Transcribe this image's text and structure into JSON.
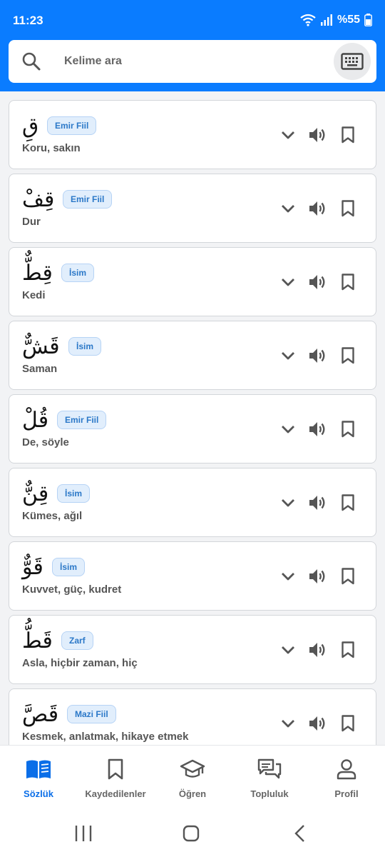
{
  "status": {
    "time": "11:23",
    "battery": "%55"
  },
  "search": {
    "placeholder": "Kelime ara"
  },
  "entries": [
    {
      "word": "قِ",
      "type": "Emir Fiil",
      "meaning": "Koru, sakın"
    },
    {
      "word": "قِفْ",
      "type": "Emir Fiil",
      "meaning": "Dur"
    },
    {
      "word": "قِطٌّ",
      "type": "İsim",
      "meaning": "Kedi"
    },
    {
      "word": "قَشٌّ",
      "type": "İsim",
      "meaning": "Saman"
    },
    {
      "word": "قُلْ",
      "type": "Emir Fiil",
      "meaning": "De, söyle"
    },
    {
      "word": "قِنٌّ",
      "type": "İsim",
      "meaning": "Kümes, ağıl"
    },
    {
      "word": "قَوٌّ",
      "type": "İsim",
      "meaning": "Kuvvet, güç, kudret"
    },
    {
      "word": "قَطُّ",
      "type": "Zarf",
      "meaning": "Asla, hiçbir zaman, hiç"
    },
    {
      "word": "قَصَّ",
      "type": "Mazi Fiil",
      "meaning": "Kesmek, anlatmak, hikaye etmek"
    }
  ],
  "nav": [
    {
      "label": "Sözlük",
      "icon": "book-open-icon",
      "active": true
    },
    {
      "label": "Kaydedilenler",
      "icon": "bookmark-icon",
      "active": false
    },
    {
      "label": "Öğren",
      "icon": "graduation-cap-icon",
      "active": false
    },
    {
      "label": "Topluluk",
      "icon": "chat-bubbles-icon",
      "active": false
    },
    {
      "label": "Profil",
      "icon": "person-icon",
      "active": false
    }
  ],
  "colors": {
    "primary": "#0a7cff",
    "active_nav": "#0a6ee8",
    "badge_bg": "#e1eefc",
    "badge_text": "#2b78c8",
    "icon_gray": "#555555"
  }
}
